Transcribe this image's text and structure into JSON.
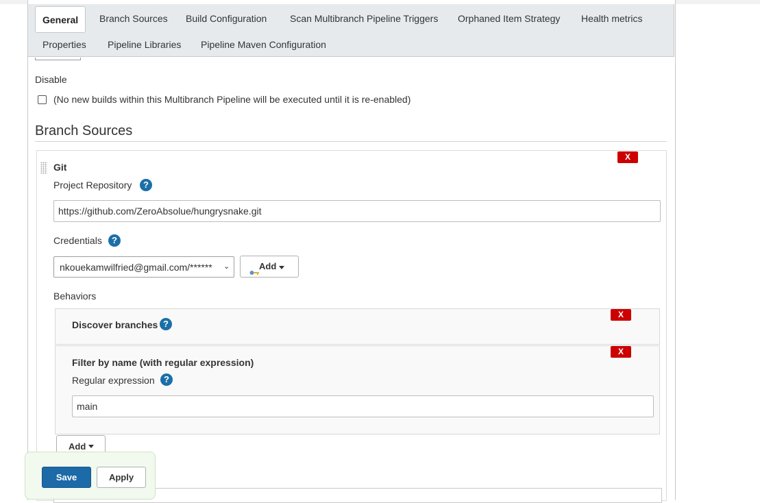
{
  "tabs": [
    {
      "label": "General",
      "active": true
    },
    {
      "label": "Branch Sources"
    },
    {
      "label": "Build Configuration"
    },
    {
      "label": "Scan Multibranch Pipeline Triggers"
    },
    {
      "label": "Orphaned Item Strategy"
    },
    {
      "label": "Health metrics"
    },
    {
      "label": "Properties"
    },
    {
      "label": "Pipeline Libraries"
    },
    {
      "label": "Pipeline Maven Configuration"
    }
  ],
  "disable": {
    "label": "Disable",
    "checkbox_text": "(No new builds within this Multibranch Pipeline will be executed until it is re-enabled)",
    "checked": false
  },
  "branch_sources": {
    "title": "Branch Sources",
    "source": {
      "name": "Git",
      "delete_label": "X",
      "project_repository": {
        "label": "Project Repository",
        "value": "https://github.com/ZeroAbsolue/hungrysnake.git"
      },
      "credentials": {
        "label": "Credentials",
        "selected": "nkouekamwilfried@gmail.com/******",
        "add_label": "Add"
      },
      "behaviors": {
        "label": "Behaviors",
        "items": [
          {
            "title": "Discover branches",
            "delete_label": "X"
          },
          {
            "title": "Filter by name (with regular expression)",
            "delete_label": "X",
            "field_label": "Regular expression",
            "field_value": "main"
          }
        ],
        "add_label": "Add"
      }
    }
  },
  "help_glyph": "?",
  "footer": {
    "save_label": "Save",
    "apply_label": "Apply"
  },
  "colors": {
    "primary": "#1c6aa7",
    "danger": "#cc0000",
    "help": "#1b6fa8",
    "tabbar": "#e6eaed"
  }
}
